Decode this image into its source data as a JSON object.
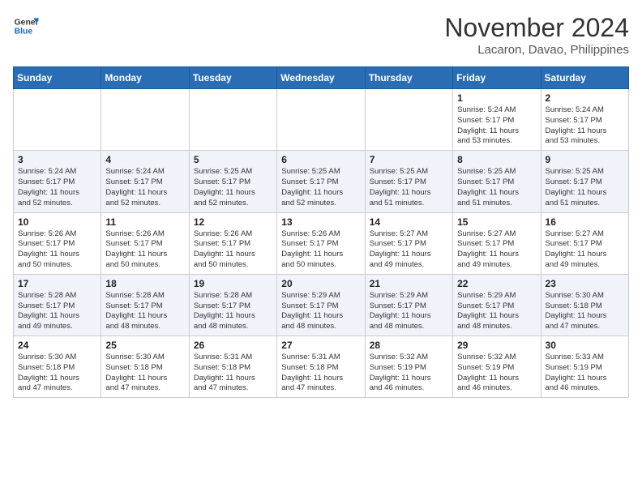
{
  "header": {
    "logo_line1": "General",
    "logo_line2": "Blue",
    "month": "November 2024",
    "location": "Lacaron, Davao, Philippines"
  },
  "days_of_week": [
    "Sunday",
    "Monday",
    "Tuesday",
    "Wednesday",
    "Thursday",
    "Friday",
    "Saturday"
  ],
  "weeks": [
    [
      {
        "day": "",
        "info": ""
      },
      {
        "day": "",
        "info": ""
      },
      {
        "day": "",
        "info": ""
      },
      {
        "day": "",
        "info": ""
      },
      {
        "day": "",
        "info": ""
      },
      {
        "day": "1",
        "info": "Sunrise: 5:24 AM\nSunset: 5:17 PM\nDaylight: 11 hours\nand 53 minutes."
      },
      {
        "day": "2",
        "info": "Sunrise: 5:24 AM\nSunset: 5:17 PM\nDaylight: 11 hours\nand 53 minutes."
      }
    ],
    [
      {
        "day": "3",
        "info": "Sunrise: 5:24 AM\nSunset: 5:17 PM\nDaylight: 11 hours\nand 52 minutes."
      },
      {
        "day": "4",
        "info": "Sunrise: 5:24 AM\nSunset: 5:17 PM\nDaylight: 11 hours\nand 52 minutes."
      },
      {
        "day": "5",
        "info": "Sunrise: 5:25 AM\nSunset: 5:17 PM\nDaylight: 11 hours\nand 52 minutes."
      },
      {
        "day": "6",
        "info": "Sunrise: 5:25 AM\nSunset: 5:17 PM\nDaylight: 11 hours\nand 52 minutes."
      },
      {
        "day": "7",
        "info": "Sunrise: 5:25 AM\nSunset: 5:17 PM\nDaylight: 11 hours\nand 51 minutes."
      },
      {
        "day": "8",
        "info": "Sunrise: 5:25 AM\nSunset: 5:17 PM\nDaylight: 11 hours\nand 51 minutes."
      },
      {
        "day": "9",
        "info": "Sunrise: 5:25 AM\nSunset: 5:17 PM\nDaylight: 11 hours\nand 51 minutes."
      }
    ],
    [
      {
        "day": "10",
        "info": "Sunrise: 5:26 AM\nSunset: 5:17 PM\nDaylight: 11 hours\nand 50 minutes."
      },
      {
        "day": "11",
        "info": "Sunrise: 5:26 AM\nSunset: 5:17 PM\nDaylight: 11 hours\nand 50 minutes."
      },
      {
        "day": "12",
        "info": "Sunrise: 5:26 AM\nSunset: 5:17 PM\nDaylight: 11 hours\nand 50 minutes."
      },
      {
        "day": "13",
        "info": "Sunrise: 5:26 AM\nSunset: 5:17 PM\nDaylight: 11 hours\nand 50 minutes."
      },
      {
        "day": "14",
        "info": "Sunrise: 5:27 AM\nSunset: 5:17 PM\nDaylight: 11 hours\nand 49 minutes."
      },
      {
        "day": "15",
        "info": "Sunrise: 5:27 AM\nSunset: 5:17 PM\nDaylight: 11 hours\nand 49 minutes."
      },
      {
        "day": "16",
        "info": "Sunrise: 5:27 AM\nSunset: 5:17 PM\nDaylight: 11 hours\nand 49 minutes."
      }
    ],
    [
      {
        "day": "17",
        "info": "Sunrise: 5:28 AM\nSunset: 5:17 PM\nDaylight: 11 hours\nand 49 minutes."
      },
      {
        "day": "18",
        "info": "Sunrise: 5:28 AM\nSunset: 5:17 PM\nDaylight: 11 hours\nand 48 minutes."
      },
      {
        "day": "19",
        "info": "Sunrise: 5:28 AM\nSunset: 5:17 PM\nDaylight: 11 hours\nand 48 minutes."
      },
      {
        "day": "20",
        "info": "Sunrise: 5:29 AM\nSunset: 5:17 PM\nDaylight: 11 hours\nand 48 minutes."
      },
      {
        "day": "21",
        "info": "Sunrise: 5:29 AM\nSunset: 5:17 PM\nDaylight: 11 hours\nand 48 minutes."
      },
      {
        "day": "22",
        "info": "Sunrise: 5:29 AM\nSunset: 5:17 PM\nDaylight: 11 hours\nand 48 minutes."
      },
      {
        "day": "23",
        "info": "Sunrise: 5:30 AM\nSunset: 5:18 PM\nDaylight: 11 hours\nand 47 minutes."
      }
    ],
    [
      {
        "day": "24",
        "info": "Sunrise: 5:30 AM\nSunset: 5:18 PM\nDaylight: 11 hours\nand 47 minutes."
      },
      {
        "day": "25",
        "info": "Sunrise: 5:30 AM\nSunset: 5:18 PM\nDaylight: 11 hours\nand 47 minutes."
      },
      {
        "day": "26",
        "info": "Sunrise: 5:31 AM\nSunset: 5:18 PM\nDaylight: 11 hours\nand 47 minutes."
      },
      {
        "day": "27",
        "info": "Sunrise: 5:31 AM\nSunset: 5:18 PM\nDaylight: 11 hours\nand 47 minutes."
      },
      {
        "day": "28",
        "info": "Sunrise: 5:32 AM\nSunset: 5:19 PM\nDaylight: 11 hours\nand 46 minutes."
      },
      {
        "day": "29",
        "info": "Sunrise: 5:32 AM\nSunset: 5:19 PM\nDaylight: 11 hours\nand 46 minutes."
      },
      {
        "day": "30",
        "info": "Sunrise: 5:33 AM\nSunset: 5:19 PM\nDaylight: 11 hours\nand 46 minutes."
      }
    ]
  ]
}
